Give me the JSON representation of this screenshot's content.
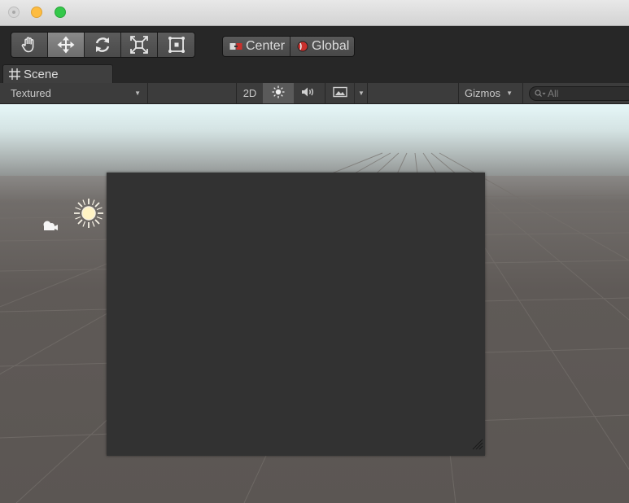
{
  "window": {
    "traffic_lights": [
      "close",
      "minimize",
      "maximize"
    ]
  },
  "toolbar": {
    "tools": [
      {
        "icon": "hand-icon",
        "active": false
      },
      {
        "icon": "move-icon",
        "active": true
      },
      {
        "icon": "rotate-icon",
        "active": false
      },
      {
        "icon": "scale-icon",
        "active": false
      },
      {
        "icon": "rect-tool-icon",
        "active": false
      }
    ],
    "pivot_label": "Center",
    "rotation_label": "Global"
  },
  "tab": {
    "label": "Scene",
    "icon": "grid-icon"
  },
  "scene_header": {
    "draw_mode": "Textured",
    "btn_2d": "2D",
    "lighting_icon": "sun-icon",
    "audio_icon": "speaker-icon",
    "effects_icon": "image-icon",
    "gizmos_label": "Gizmos",
    "search_placeholder": "All"
  },
  "colors": {
    "sky_top": "#e6f7f8",
    "ground": "#5b5653",
    "panel": "#323232",
    "toolbar": "#272727",
    "active_tool": "#7c7c7c"
  }
}
